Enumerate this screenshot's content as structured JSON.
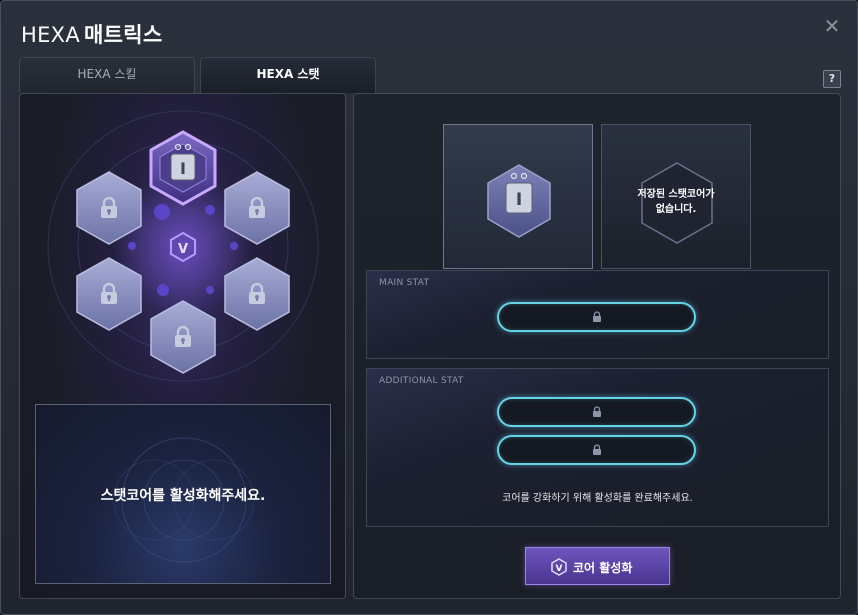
{
  "window": {
    "title_en": "HEXA",
    "title_ko": "매트릭스",
    "close_label": "✕",
    "help_label": "?"
  },
  "tabs": [
    {
      "label": "HEXA 스킬",
      "active": false
    },
    {
      "label": "HEXA 스탯",
      "active": true
    }
  ],
  "matrix": {
    "center_icon": "hexa-emblem-icon",
    "slots": [
      {
        "position": "top",
        "state": "active-core",
        "icon": "stat-core-icon"
      },
      {
        "position": "upper-left",
        "state": "locked",
        "icon": "lock-icon"
      },
      {
        "position": "upper-right",
        "state": "locked",
        "icon": "lock-icon"
      },
      {
        "position": "lower-left",
        "state": "locked",
        "icon": "lock-icon"
      },
      {
        "position": "lower-right",
        "state": "locked",
        "icon": "lock-icon"
      },
      {
        "position": "bottom",
        "state": "locked",
        "icon": "lock-icon"
      }
    ],
    "info_message": "스탯코어를 활성화해주세요."
  },
  "core_slots": {
    "current_icon": "stat-core-icon",
    "saved_empty_text_line1": "저장된 스탯코어가",
    "saved_empty_text_line2": "없습니다."
  },
  "main_stat": {
    "label": "MAIN STAT",
    "slots": [
      {
        "state": "locked",
        "icon": "lock-icon"
      }
    ]
  },
  "additional_stat": {
    "label": "ADDITIONAL STAT",
    "slots": [
      {
        "state": "locked",
        "icon": "lock-icon"
      },
      {
        "state": "locked",
        "icon": "lock-icon"
      }
    ],
    "hint": "코어를 강화하기 위해 활성화를 완료해주세요."
  },
  "activate_button": {
    "label": "코어 활성화",
    "icon": "hexa-emblem-icon"
  },
  "colors": {
    "accent_purple": "#6d55bd",
    "slot_glow_cyan": "#66d2e6",
    "active_hex_border": "#c9a8ff"
  }
}
